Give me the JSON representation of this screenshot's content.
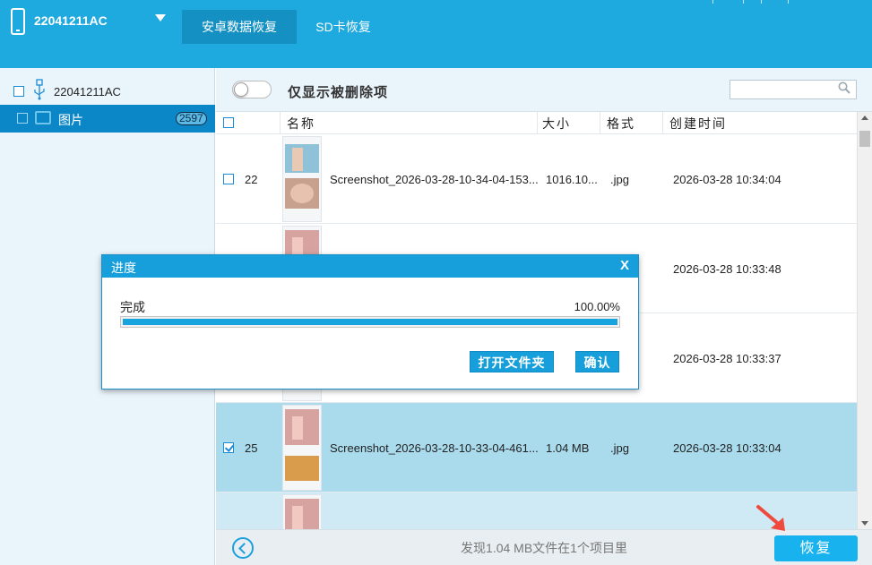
{
  "header": {
    "device_name": "22041211AC",
    "tabs": [
      {
        "label": "安卓数据恢复",
        "active": true
      },
      {
        "label": "SD卡恢复",
        "active": false
      }
    ]
  },
  "sidebar": {
    "root_label": "22041211AC",
    "items": [
      {
        "label": "图片",
        "count": "2597",
        "selected": true
      }
    ]
  },
  "toolbar": {
    "filter_label": "仅显示被删除项",
    "filter_on": false,
    "search_value": ""
  },
  "table": {
    "columns": [
      "名称",
      "大小",
      "格式",
      "创建时间"
    ],
    "rows": [
      {
        "no": "22",
        "name": "Screenshot_2026-03-28-10-34-04-153...",
        "size": "1016.10...",
        "format": ".jpg",
        "time": "2026-03-28 10:34:04",
        "checked": false
      },
      {
        "no": "",
        "name": "",
        "size": "",
        "format": "",
        "time": "2026-03-28 10:33:48",
        "checked": false
      },
      {
        "no": "",
        "name": "",
        "size": "",
        "format": "",
        "time": "2026-03-28 10:33:37",
        "checked": false
      },
      {
        "no": "25",
        "name": "Screenshot_2026-03-28-10-33-04-461...",
        "size": "1.04 MB",
        "format": ".jpg",
        "time": "2026-03-28 10:33:04",
        "checked": true
      }
    ]
  },
  "footer": {
    "status": "发现1.04 MB文件在1个项目里",
    "recover_label": "恢复"
  },
  "dialog": {
    "title": "进度",
    "close": "X",
    "status": "完成",
    "percent": "100.00%",
    "progress": 1.0,
    "open_folder_label": "打开文件夹",
    "ok_label": "确认"
  },
  "colors": {
    "accent": "#1ea9df",
    "selected_row": "#a9dbed",
    "pointer_arrow": "#f04a3e"
  }
}
